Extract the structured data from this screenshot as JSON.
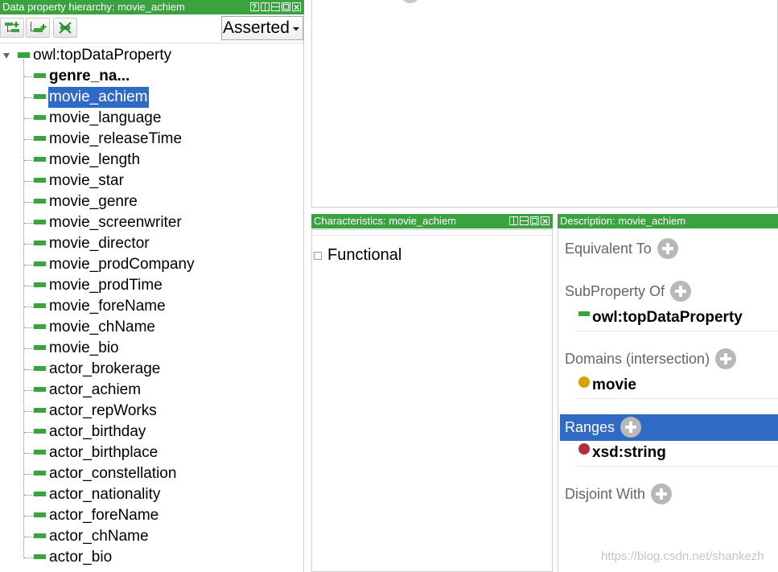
{
  "left_panel": {
    "title": "Data property hierarchy: movie_achiem",
    "mode": "Asserted",
    "root": "owl:topDataProperty",
    "items": [
      {
        "label": "genre_na...",
        "bold": true
      },
      {
        "label": "movie_achiem",
        "selected": true
      },
      {
        "label": "movie_language"
      },
      {
        "label": "movie_releaseTime"
      },
      {
        "label": "movie_length"
      },
      {
        "label": "movie_star"
      },
      {
        "label": "movie_genre"
      },
      {
        "label": "movie_screenwriter"
      },
      {
        "label": "movie_director"
      },
      {
        "label": "movie_prodCompany"
      },
      {
        "label": "movie_prodTime"
      },
      {
        "label": "movie_foreName"
      },
      {
        "label": "movie_chName"
      },
      {
        "label": "movie_bio"
      },
      {
        "label": "actor_brokerage"
      },
      {
        "label": "actor_achiem"
      },
      {
        "label": "actor_repWorks"
      },
      {
        "label": "actor_birthday"
      },
      {
        "label": "actor_birthplace"
      },
      {
        "label": "actor_constellation"
      },
      {
        "label": "actor_nationality"
      },
      {
        "label": "actor_foreName"
      },
      {
        "label": "actor_chName"
      },
      {
        "label": "actor_bio"
      }
    ]
  },
  "characteristics": {
    "title": "Characteristics: movie_achiem",
    "functional_label": "Functional",
    "functional_checked": false
  },
  "description": {
    "title": "Description: movie_achiem",
    "equivalent_to": "Equivalent To",
    "subproperty_of": "SubProperty Of",
    "subproperty_value": "owl:topDataProperty",
    "domains": "Domains (intersection)",
    "domain_value": "movie",
    "ranges": "Ranges",
    "range_value": "xsd:string",
    "disjoint_with": "Disjoint With"
  },
  "colors": {
    "accent_green": "#3aa33f",
    "selection_blue": "#2f6bc4",
    "class_dot": "#d4a400",
    "datatype_dot": "#b03040"
  },
  "watermark": "https://blog.csdn.net/shankezh"
}
